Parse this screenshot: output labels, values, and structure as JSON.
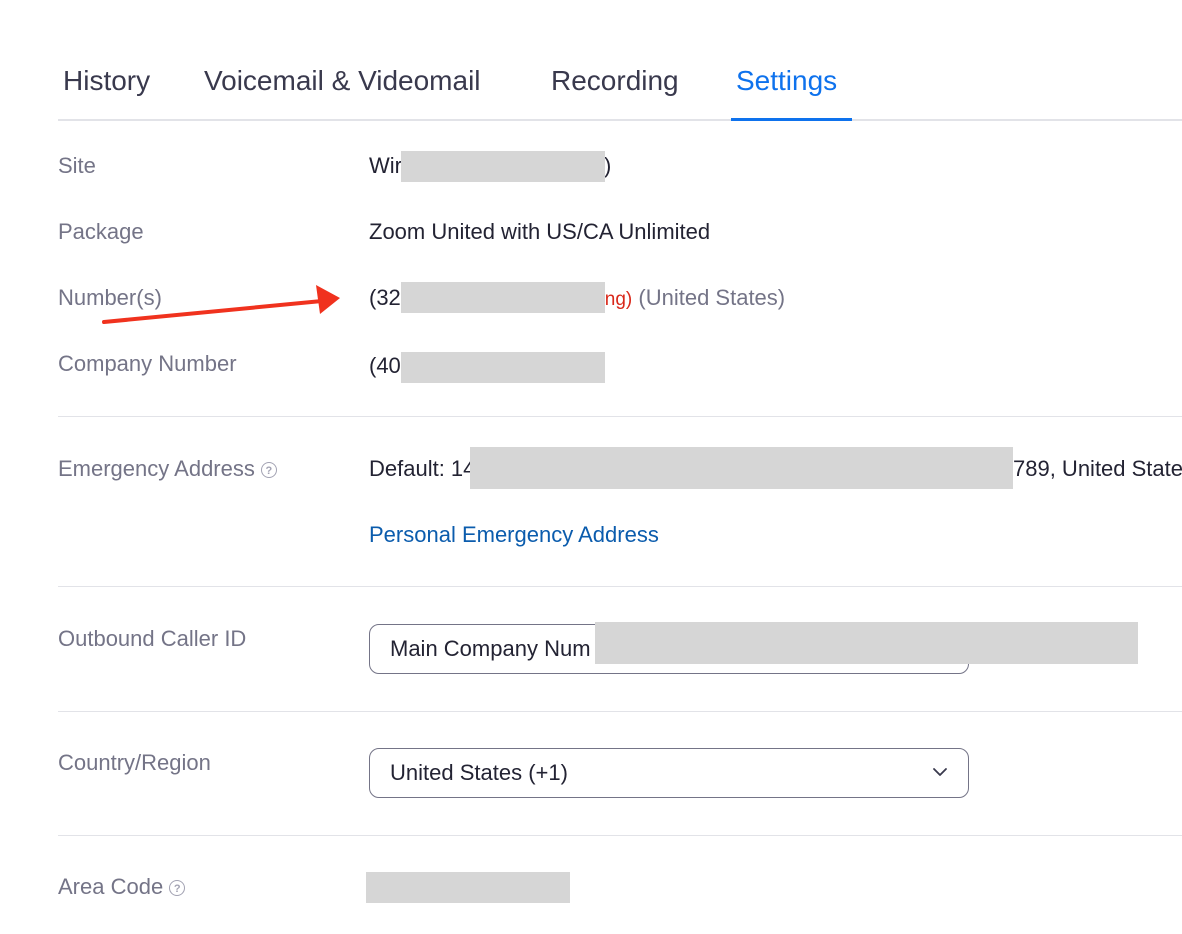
{
  "tabs": [
    {
      "label": "History"
    },
    {
      "label": "Voicemail & Videomail"
    },
    {
      "label": "Recording"
    },
    {
      "label": "Settings"
    }
  ],
  "active_tab": "Settings",
  "rows": {
    "site": {
      "label": "Site",
      "value_prefix": "Wir",
      "value_suffix": ")"
    },
    "package": {
      "label": "Package",
      "value": "Zoom United with US/CA Unlimited"
    },
    "numbers": {
      "label": "Number(s)",
      "value_prefix": "(32",
      "status_fragment": "ng)",
      "country": "(United States)"
    },
    "company_number": {
      "label": "Company Number",
      "value_prefix": "(40"
    },
    "emergency_address": {
      "label": "Emergency Address",
      "value_prefix": "Default: 14",
      "value_suffix": "789, United State",
      "link": "Personal Emergency Address"
    },
    "outbound_caller_id": {
      "label": "Outbound Caller ID",
      "selected": "Main Company Num"
    },
    "country_region": {
      "label": "Country/Region",
      "selected": "United States (+1)"
    },
    "area_code": {
      "label": "Area Code"
    }
  },
  "icons": {
    "help": "question-circle-icon",
    "chevron": "chevron-down-icon",
    "annotation": "red-arrow"
  },
  "colors": {
    "accent": "#0e72ed",
    "link": "#0b5cad",
    "annotation": "#f0321e",
    "warning_text": "#d9281a"
  }
}
